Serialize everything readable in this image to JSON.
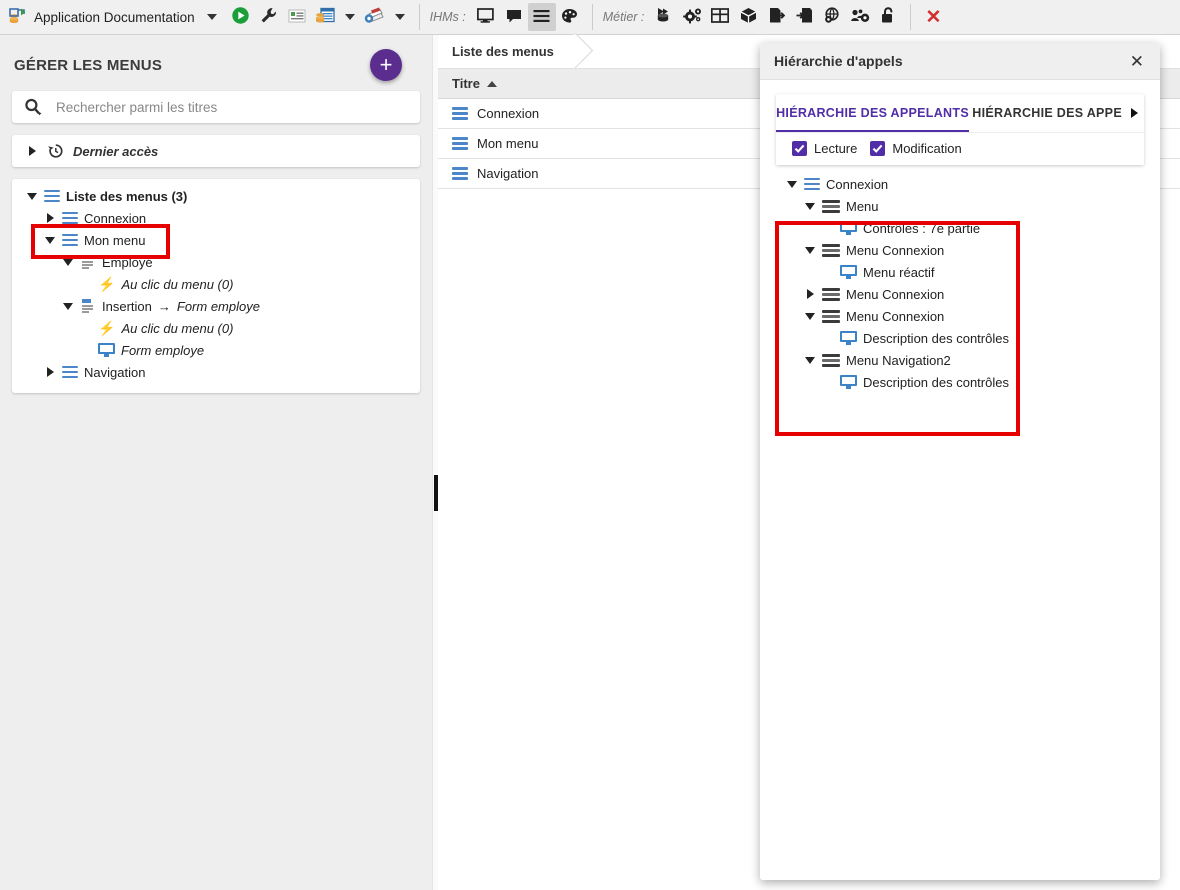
{
  "toolbar": {
    "app_icon": "application-documentation-icon",
    "app_name": "Application Documentation",
    "run_icon": "run-play-icon",
    "wrench_icon": "wrench-icon",
    "report_icon": "report-icon",
    "database_table_icon": "database-table-icon",
    "books_icon": "books-gear-icon",
    "ihms_label": "IHMs :",
    "ihms_icons": [
      "screen-icon",
      "window-icon",
      "menu-icon",
      "palette-icon"
    ],
    "metier_label": "Métier :",
    "metier_icons": [
      "database-flow-icon",
      "gears-icon",
      "table-grid-icon",
      "cube-icon",
      "file-export-icon",
      "file-import-icon",
      "globe-gear-icon",
      "users-gear-icon",
      "unlock-icon"
    ],
    "close_icon": "close-x-icon"
  },
  "left_panel": {
    "title": "GÉRER LES MENUS",
    "add_button_label": "+",
    "search": {
      "icon": "search-icon",
      "placeholder": "Rechercher parmi les titres",
      "value": ""
    },
    "recent": {
      "icon": "history-clock-icon",
      "label": "Dernier accès",
      "expanded": false
    },
    "tree": [
      {
        "label": "Liste des menus (3)",
        "icon": "menu-blue-icon",
        "depth": 0,
        "expanded": true,
        "bold": true,
        "highlight": false
      },
      {
        "label": "Connexion",
        "icon": "menu-blue-icon",
        "depth": 1,
        "expanded": false,
        "bold": false,
        "highlight": true
      },
      {
        "label": "Mon menu",
        "icon": "menu-blue-icon",
        "depth": 1,
        "expanded": true,
        "bold": false,
        "highlight": false
      },
      {
        "label": "Employé",
        "icon": "menu-item-icon",
        "depth": 2,
        "expanded": true,
        "bold": false,
        "highlight": false
      },
      {
        "label": "Au clic du menu (0)",
        "icon": "bolt-icon",
        "depth": 3,
        "expanded": null,
        "italic": true,
        "highlight": false
      },
      {
        "label": "Insertion",
        "suffix_arrow": "→",
        "suffix": "Form employe",
        "icon": "menu-item-icon",
        "depth": 2,
        "expanded": true,
        "highlight": false
      },
      {
        "label": "Au clic du menu (0)",
        "icon": "bolt-icon",
        "depth": 3,
        "expanded": null,
        "italic": true,
        "highlight": false
      },
      {
        "label": "Form employe",
        "icon": "screen-icon",
        "depth": 3,
        "expanded": null,
        "italic": true,
        "highlight": false
      },
      {
        "label": "Navigation",
        "icon": "menu-blue-icon",
        "depth": 1,
        "expanded": false,
        "highlight": false
      }
    ]
  },
  "main": {
    "breadcrumb": "Liste des menus",
    "column_header": "Titre",
    "sort_direction": "asc",
    "rows": [
      {
        "icon": "menu-blue-icon",
        "title": "Connexion"
      },
      {
        "icon": "menu-blue-icon",
        "title": "Mon menu"
      },
      {
        "icon": "menu-blue-icon",
        "title": "Navigation"
      }
    ]
  },
  "dialog": {
    "title": "Hiérarchie d'appels",
    "close_icon": "close-icon",
    "tabs": [
      {
        "label": "HIÉRARCHIE DES APPELANTS",
        "selected": true
      },
      {
        "label": "HIÉRARCHIE DES APPE",
        "selected": false
      }
    ],
    "tab_next_icon": "chevron-right-icon",
    "checkboxes": [
      {
        "label": "Lecture",
        "checked": true
      },
      {
        "label": "Modification",
        "checked": true
      }
    ],
    "tree": [
      {
        "label": "Connexion",
        "icon": "menu-blue-icon",
        "depth": 0,
        "expanded": true
      },
      {
        "label": "Menu",
        "icon": "menu-dark-icon",
        "depth": 1,
        "expanded": true
      },
      {
        "label": "Contrôles : 7e partie",
        "icon": "screen-icon",
        "depth": 2,
        "expanded": null
      },
      {
        "label": "Menu Connexion",
        "icon": "menu-dark-icon",
        "depth": 1,
        "expanded": true
      },
      {
        "label": "Menu réactif",
        "icon": "screen-icon",
        "depth": 2,
        "expanded": null
      },
      {
        "label": "Menu Connexion",
        "icon": "menu-dark-icon",
        "depth": 1,
        "expanded": false
      },
      {
        "label": "Menu Connexion",
        "icon": "menu-dark-icon",
        "depth": 1,
        "expanded": true
      },
      {
        "label": "Description des contrôles",
        "icon": "screen-icon",
        "depth": 2,
        "expanded": null
      },
      {
        "label": "Menu Navigation2",
        "icon": "menu-dark-icon",
        "depth": 1,
        "expanded": true
      },
      {
        "label": "Description des contrôles",
        "icon": "screen-icon",
        "depth": 2,
        "expanded": null
      }
    ]
  },
  "colors": {
    "accent_purple": "#512da8",
    "fab_purple": "#5b2d8e",
    "annotation_red": "#e60000",
    "tree_blue": "#4a86c8",
    "link_green": "#2e8b3d",
    "close_red": "#d32f2f"
  }
}
